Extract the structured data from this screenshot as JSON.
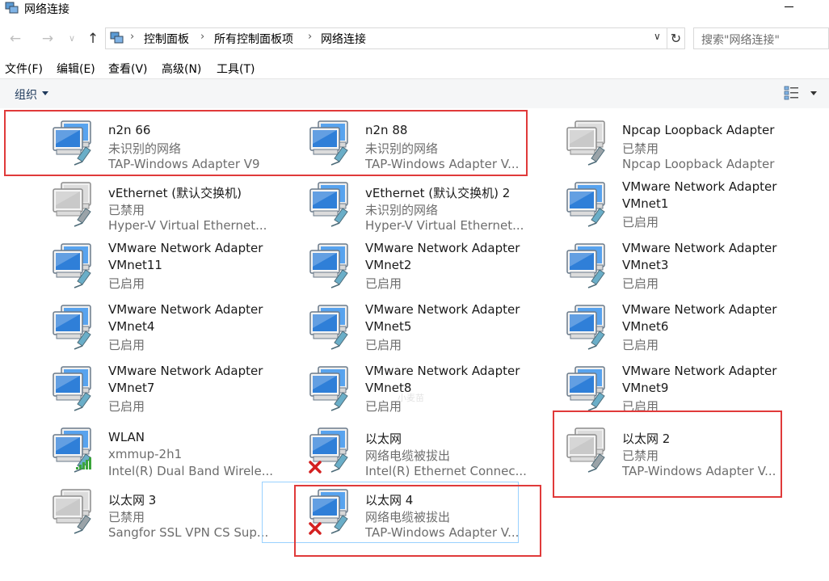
{
  "window": {
    "title": "网络连接"
  },
  "nav": {
    "back": "←",
    "forward": "→",
    "recent": "∨",
    "up": "↑",
    "breadcrumb": [
      "控制面板",
      "所有控制面板项",
      "网络连接"
    ],
    "separator": "›",
    "dropdown": "∨",
    "refresh": "↻",
    "search_placeholder": "搜索\"网络连接\""
  },
  "menu": [
    "文件(F)",
    "编辑(E)",
    "查看(V)",
    "高级(N)",
    "工具(T)"
  ],
  "toolbar": {
    "organize": "组织"
  },
  "adapters": [
    {
      "name": "n2n 66",
      "status": "未识别的网络",
      "device": "TAP-Windows Adapter V9",
      "state": "connected"
    },
    {
      "name": "n2n 88",
      "status": "未识别的网络",
      "device": "TAP-Windows Adapter V...",
      "state": "connected"
    },
    {
      "name": "Npcap Loopback Adapter",
      "status": "已禁用",
      "device": "Npcap Loopback Adapter",
      "state": "disabled"
    },
    {
      "name": "vEthernet (默认交换机)",
      "status": "已禁用",
      "device": "Hyper-V Virtual Ethernet...",
      "state": "disabled"
    },
    {
      "name": "vEthernet (默认交换机) 2",
      "status": "未识别的网络",
      "device": "Hyper-V Virtual Ethernet...",
      "state": "connected"
    },
    {
      "name": "VMware Network Adapter",
      "status": "VMnet1",
      "device": "已启用",
      "state": "connected"
    },
    {
      "name": "VMware Network Adapter",
      "status": "VMnet11",
      "device": "已启用",
      "state": "connected"
    },
    {
      "name": "VMware Network Adapter",
      "status": "VMnet2",
      "device": "已启用",
      "state": "connected"
    },
    {
      "name": "VMware Network Adapter",
      "status": "VMnet3",
      "device": "已启用",
      "state": "connected"
    },
    {
      "name": "VMware Network Adapter",
      "status": "VMnet4",
      "device": "已启用",
      "state": "connected"
    },
    {
      "name": "VMware Network Adapter",
      "status": "VMnet5",
      "device": "已启用",
      "state": "connected"
    },
    {
      "name": "VMware Network Adapter",
      "status": "VMnet6",
      "device": "已启用",
      "state": "connected"
    },
    {
      "name": "VMware Network Adapter",
      "status": "VMnet7",
      "device": "已启用",
      "state": "connected"
    },
    {
      "name": "VMware Network Adapter",
      "status": "VMnet8",
      "device": "已启用",
      "state": "connected"
    },
    {
      "name": "VMware Network Adapter",
      "status": "VMnet9",
      "device": "已启用",
      "state": "connected"
    },
    {
      "name": "WLAN",
      "status": "xmmup-2h1",
      "device": "Intel(R) Dual Band Wirele...",
      "state": "wifi"
    },
    {
      "name": "以太网",
      "status": "网络电缆被拔出",
      "device": "Intel(R) Ethernet Connec...",
      "state": "unplugged"
    },
    {
      "name": "以太网 2",
      "status": "已禁用",
      "device": "TAP-Windows Adapter V...",
      "state": "disabled"
    },
    {
      "name": "以太网 3",
      "status": "已禁用",
      "device": "Sangfor SSL VPN CS Sup...",
      "state": "disabled"
    },
    {
      "name": "以太网 4",
      "status": "网络电缆被拔出",
      "device": "TAP-Windows Adapter V...",
      "state": "unplugged"
    }
  ],
  "watermark": "小麦苗",
  "colors": {
    "highlight_box": "#e03a3a",
    "selection": "#99d1ff",
    "toolbar_text": "#1e395b"
  }
}
